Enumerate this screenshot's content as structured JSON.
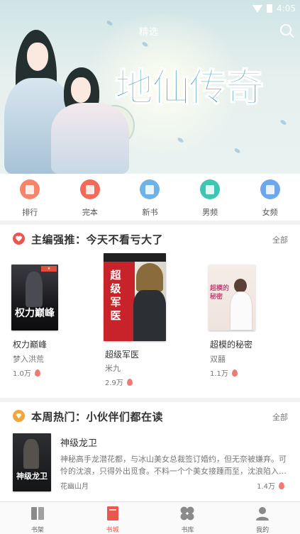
{
  "status_bar": {
    "time": "4:05"
  },
  "banner": {
    "top_title": "精选",
    "logo_text": "地仙传奇"
  },
  "categories": [
    {
      "label": "排行",
      "icon": "ranking-icon",
      "color": "#f5846b"
    },
    {
      "label": "完本",
      "icon": "completed-book-icon",
      "color": "#f26a5a"
    },
    {
      "label": "新书",
      "icon": "new-book-icon",
      "color": "#6fb3e6"
    },
    {
      "label": "男频",
      "icon": "male-channel-icon",
      "color": "#3fc6b3"
    },
    {
      "label": "女频",
      "icon": "female-channel-icon",
      "color": "#6fa7ef"
    }
  ],
  "section_editor": {
    "title": "主编强推：今天不看亏大了",
    "more": "全部",
    "books": [
      {
        "title": "权力巅峰",
        "author": "梦入洪荒",
        "count": "1.0万",
        "cover_text": "权力巅峰"
      },
      {
        "title": "超级军医",
        "author": "米九",
        "count": "2.9万",
        "cover_text": "超级军医"
      },
      {
        "title": "超模的秘密",
        "author": "双囍",
        "count": "1.1万",
        "cover_text": "超模的秘密"
      }
    ]
  },
  "section_hot": {
    "title": "本周热门：小伙伴们都在读",
    "more": "全部",
    "book": {
      "title": "神级龙卫",
      "description": "神秘高手龙潜花都，与冰山美女总裁签订婚约，但无奈被嫌弃。可怜的沈浪，只得外出觅食。不料一个个美女接踵而至，沈浪陷入各种…",
      "author": "花幽山月",
      "count": "1.4万",
      "cover_text": "神级龙卫"
    }
  },
  "bottom_nav": [
    {
      "label": "书架",
      "icon": "bookshelf-icon",
      "active": false
    },
    {
      "label": "书城",
      "icon": "bookstore-icon",
      "active": true
    },
    {
      "label": "书库",
      "icon": "library-icon",
      "active": false
    },
    {
      "label": "我的",
      "icon": "profile-icon",
      "active": false
    }
  ],
  "colors": {
    "accent": "#e9574f",
    "section_icon_editor": "#e9574f",
    "section_icon_hot": "#f0a63a"
  }
}
